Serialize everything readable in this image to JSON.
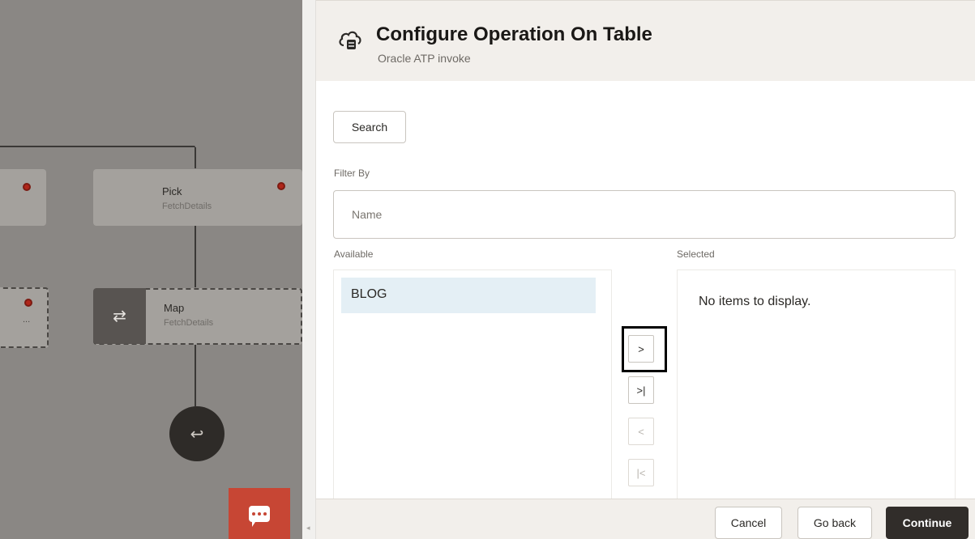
{
  "canvas": {
    "nodes": [
      {
        "title": "Pick",
        "subtitle": "FetchDetails"
      },
      {
        "title": "Map",
        "subtitle": "FetchDetails"
      }
    ],
    "partial_node_overflow": "...",
    "map_icon": "swap-arrows-icon",
    "back_icon": "undo-arrow-icon",
    "chat_icon": "chat-bubble-icon",
    "colors": {
      "error_dot": "#b0261a",
      "chat_button": "#c74634",
      "canvas_overlay": "#8a8784"
    }
  },
  "dialog": {
    "title": "Configure Operation On Table",
    "subtitle": "Oracle ATP invoke",
    "header_icon": "cloud-database-icon",
    "search_label": "Search",
    "filter_label": "Filter By",
    "filter_placeholder": "Name",
    "available_label": "Available",
    "selected_label": "Selected",
    "available_items": [
      "BLOG"
    ],
    "selected_empty_message": "No items to display.",
    "shuttle": {
      "move_one": ">",
      "move_all": ">|",
      "remove_one": "<",
      "remove_all": "|<"
    },
    "footer": {
      "cancel_label": "Cancel",
      "go_back_label": "Go back",
      "continue_label": "Continue"
    },
    "colors": {
      "primary_button": "#312d2a",
      "selected_row": "#e4eff5"
    }
  }
}
